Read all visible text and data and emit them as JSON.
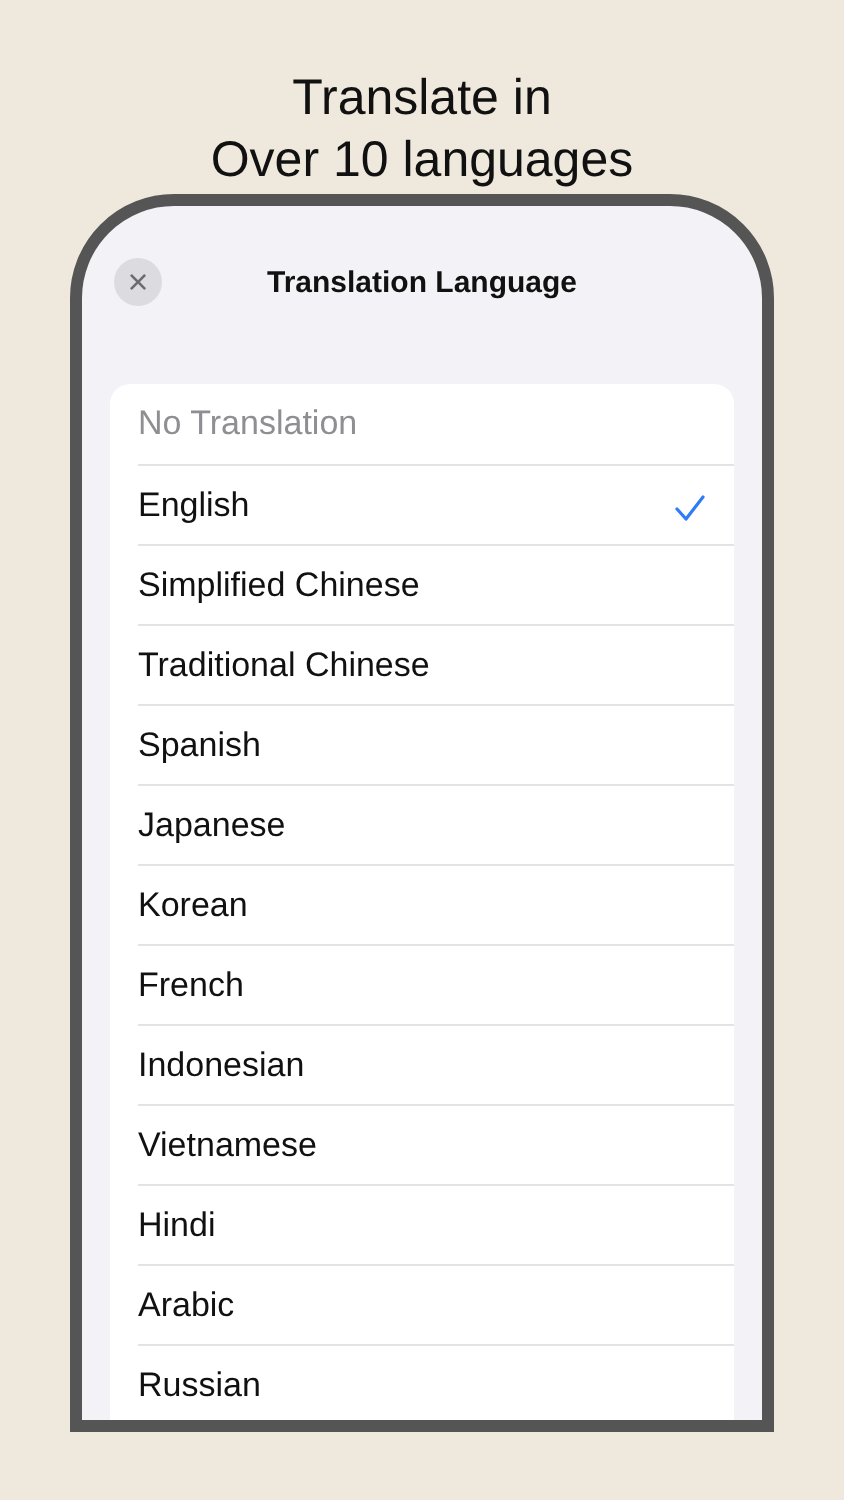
{
  "headline": "Translate in\nOver 10 languages",
  "screen": {
    "title": "Translation Language",
    "close_label": "×",
    "languages": [
      {
        "label": "No Translation",
        "selected": false,
        "disabled": true
      },
      {
        "label": "English",
        "selected": true,
        "disabled": false
      },
      {
        "label": "Simplified Chinese",
        "selected": false,
        "disabled": false
      },
      {
        "label": "Traditional Chinese",
        "selected": false,
        "disabled": false
      },
      {
        "label": "Spanish",
        "selected": false,
        "disabled": false
      },
      {
        "label": "Japanese",
        "selected": false,
        "disabled": false
      },
      {
        "label": "Korean",
        "selected": false,
        "disabled": false
      },
      {
        "label": "French",
        "selected": false,
        "disabled": false
      },
      {
        "label": "Indonesian",
        "selected": false,
        "disabled": false
      },
      {
        "label": "Vietnamese",
        "selected": false,
        "disabled": false
      },
      {
        "label": "Hindi",
        "selected": false,
        "disabled": false
      },
      {
        "label": "Arabic",
        "selected": false,
        "disabled": false
      },
      {
        "label": "Russian",
        "selected": false,
        "disabled": false
      }
    ]
  }
}
